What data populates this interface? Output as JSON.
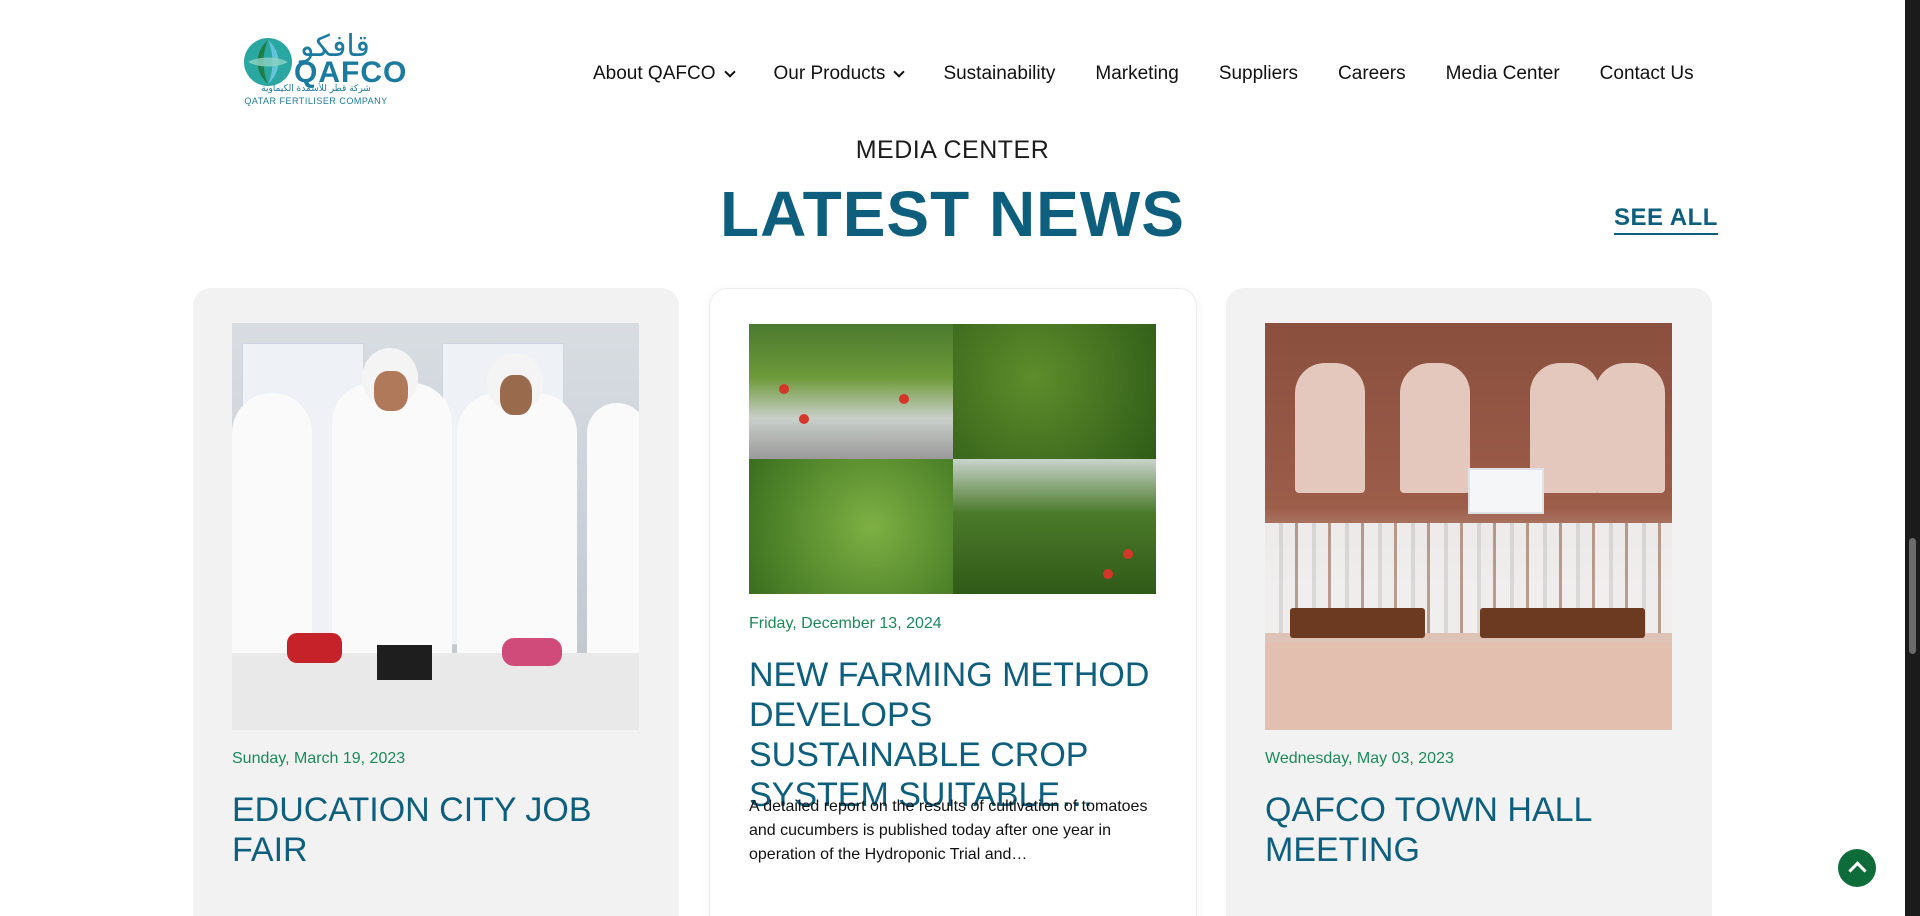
{
  "logo": {
    "arabic": "قافكو",
    "english": "QAFCO",
    "sub_arabic": "شركة قطر للأسمدة الكيماوية",
    "sub_english": "QATAR FERTILISER COMPANY"
  },
  "nav": {
    "items": [
      {
        "label": "About QAFCO",
        "dropdown": true
      },
      {
        "label": "Our Products",
        "dropdown": true
      },
      {
        "label": "Sustainability",
        "dropdown": false
      },
      {
        "label": "Marketing",
        "dropdown": false
      },
      {
        "label": "Suppliers",
        "dropdown": false
      },
      {
        "label": "Careers",
        "dropdown": false
      },
      {
        "label": "Media Center",
        "dropdown": false
      },
      {
        "label": "Contact Us",
        "dropdown": false
      }
    ]
  },
  "section": {
    "eyebrow": "MEDIA CENTER",
    "title": "LATEST NEWS",
    "see_all": "SEE ALL"
  },
  "news": [
    {
      "date": "Sunday, March 19, 2023",
      "title": "EDUCATION CITY JOB FAIR",
      "excerpt": ""
    },
    {
      "date": "Friday, December 13, 2024",
      "title": "NEW FARMING METHOD DEVELOPS SUSTAINABLE CROP SYSTEM SUITABLE…",
      "excerpt": "A detailed report on the results of cultivation of tomatoes and cucumbers is published today after one year in operation of the Hydroponic Trial and…"
    },
    {
      "date": "Wednesday, May 03, 2023",
      "title": "QAFCO TOWN HALL MEETING",
      "excerpt": ""
    }
  ],
  "colors": {
    "brand_blue": "#0e5f7e",
    "date_green": "#1b8a5a",
    "to_top_green": "#0e6b3a"
  },
  "icons": {
    "dropdown": "chevron-down-icon",
    "back_to_top": "chevron-up-icon"
  }
}
